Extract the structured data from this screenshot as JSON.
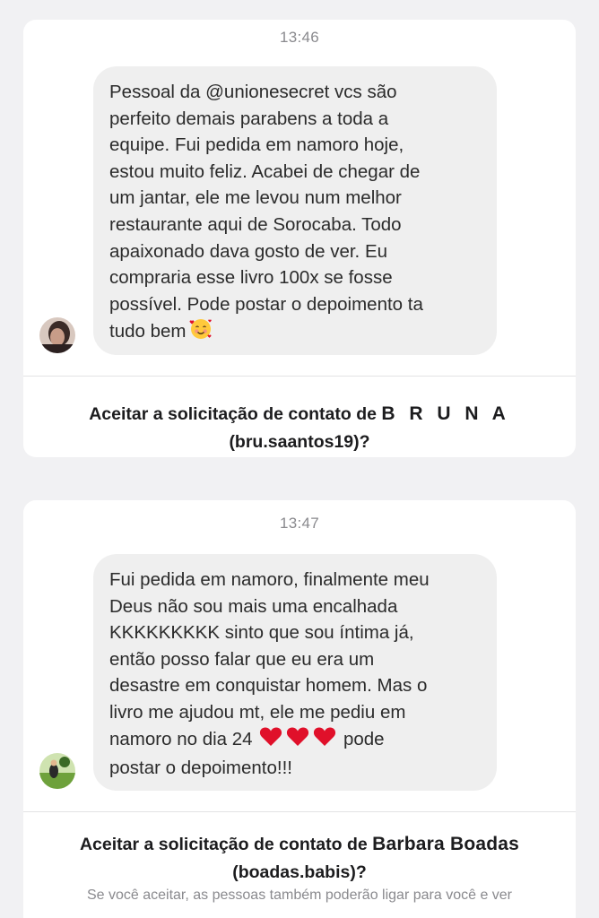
{
  "conversation_1": {
    "time": "13:46",
    "message_lines": [
      "Pessoal da @unionesecret vcs são",
      "perfeito demais parabens a toda a",
      "equipe. Fui pedida em namoro hoje,",
      "estou muito feliz. Acabei de chegar de",
      "um jantar, ele me levou num melhor",
      "restaurante aqui de Sorocaba. Todo",
      "apaixonado dava gosto de ver. Eu",
      "compraria esse livro 100x se fosse",
      "possível. Pode postar o depoimento ta",
      "tudo bem"
    ],
    "end_emoji": "smiling-face-with-hearts-icon",
    "request_prefix": "Aceitar a solicitação de contato de",
    "request_name": "B R U N A",
    "request_handle": "(bru.saantos19)?"
  },
  "conversation_2": {
    "time": "13:47",
    "message_lines": [
      "Fui pedida em namoro, finalmente meu",
      "Deus não sou mais uma encalhada",
      "KKKKKKKKK sinto que sou íntima já,",
      "então posso falar que eu era um",
      "desastre em conquistar homem. Mas o",
      "livro me ajudou mt, ele me pediu em",
      "namoro no dia 24",
      "postar o depoimento!!!"
    ],
    "line7_suffix": "pode",
    "hearts": [
      "heart-icon",
      "heart-icon",
      "heart-icon"
    ],
    "request_prefix": "Aceitar a solicitação de contato de",
    "request_name": "Barbara Boadas",
    "request_handle": "(boadas.babis)?",
    "subtext": "Se você aceitar, as pessoas também poderão ligar para você e ver"
  },
  "colors": {
    "background": "#f1f1f3",
    "card": "#ffffff",
    "bubble": "#efefef",
    "heart": "#e0102a",
    "muted_text": "#8a8a8e"
  }
}
